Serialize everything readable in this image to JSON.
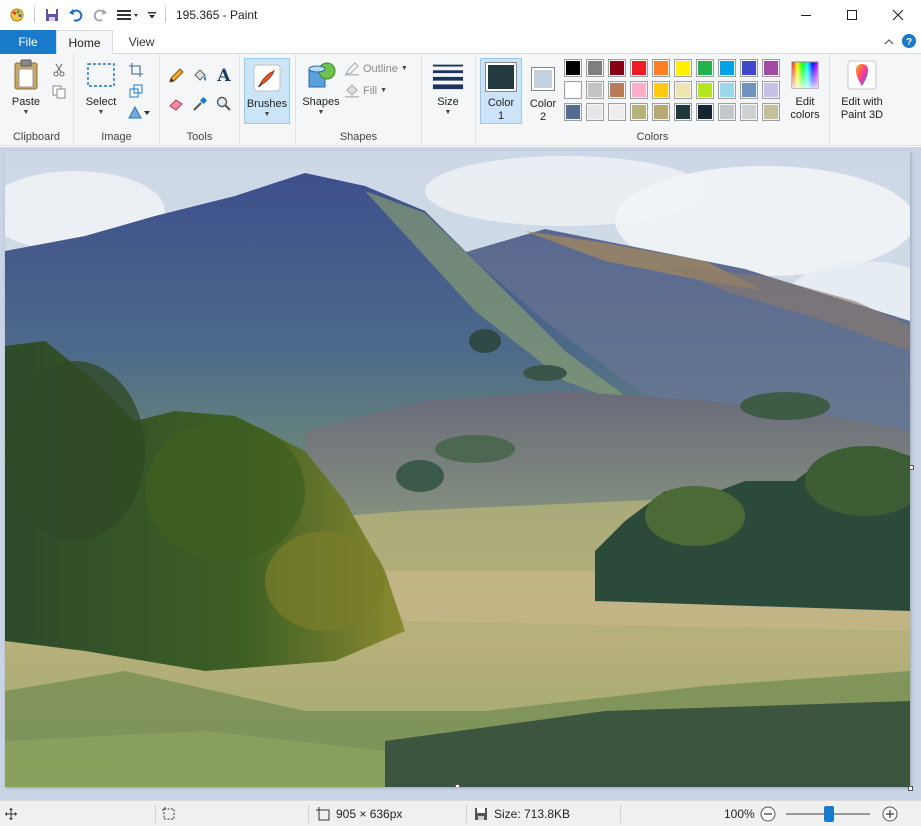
{
  "window": {
    "title": "195.365 - Paint"
  },
  "tabs": [
    {
      "label": "File"
    },
    {
      "label": "Home"
    },
    {
      "label": "View"
    }
  ],
  "ribbon": {
    "clipboard": {
      "paste": "Paste",
      "group": "Clipboard"
    },
    "image": {
      "select": "Select",
      "group": "Image"
    },
    "tools": {
      "group": "Tools",
      "text_glyph": "A"
    },
    "brushes": {
      "label": "Brushes"
    },
    "shapes": {
      "label": "Shapes",
      "outline": "Outline",
      "fill": "Fill",
      "group": "Shapes"
    },
    "size": {
      "label": "Size"
    },
    "colors": {
      "color1": "Color",
      "color1_num": "1",
      "color2": "Color",
      "color2_num": "2",
      "group": "Colors",
      "edit_colors_1": "Edit",
      "edit_colors_2": "colors",
      "color1_value": "#203a40",
      "color2_value": "#c3d0dd",
      "palette_row1": [
        "#000000",
        "#7f7f7f",
        "#880015",
        "#ed1c24",
        "#ff7f27",
        "#fff200",
        "#22b14c",
        "#00a2e8",
        "#3f48cc",
        "#a349a4"
      ],
      "palette_row2": [
        "#ffffff",
        "#c3c3c3",
        "#b97a57",
        "#ffaec9",
        "#ffc90e",
        "#efe4b0",
        "#b5e61d",
        "#99d9ea",
        "#7092be",
        "#c8bfe7"
      ],
      "palette_row3": [
        "#546c8f",
        "#e4e6ea",
        "#efedec",
        "#b6b37a",
        "#b7a876",
        "#1f3a3b",
        "#162532",
        "#c2c8cc",
        "#cdd1d3",
        "#c4c19a"
      ]
    },
    "paint3d": {
      "line1": "Edit with",
      "line2": "Paint 3D"
    }
  },
  "status": {
    "dimensions": "905 × 636px",
    "size": "Size: 713.8KB",
    "zoom": "100%",
    "zoom_level": 1.0
  }
}
